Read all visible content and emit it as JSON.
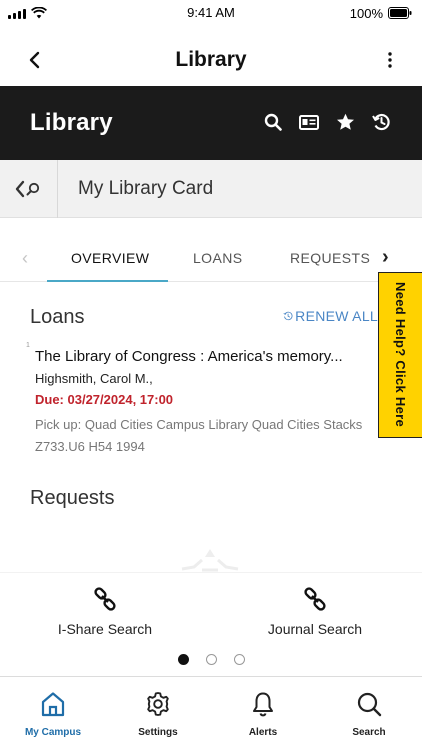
{
  "status_bar": {
    "time": "9:41 AM",
    "battery": "100%"
  },
  "app_header": {
    "title": "Library"
  },
  "banner": {
    "brand": "Library"
  },
  "card_bar": {
    "title": "My Library Card"
  },
  "tabs": [
    {
      "label": "OVERVIEW",
      "active": true
    },
    {
      "label": "LOANS",
      "active": false
    },
    {
      "label": "REQUESTS",
      "active": false
    }
  ],
  "help_tab": {
    "label": "Need Help? Click Here"
  },
  "loans": {
    "heading": "Loans",
    "renew_label": "RENEW ALL",
    "items": [
      {
        "title": "The Library of Congress : America's memory...",
        "author": "Highsmith, Carol M.,",
        "due": "Due: 03/27/2024, 17:00",
        "pickup": "Pick up: Quad Cities Campus Library Quad Cities Stacks Z733.U6 H54 1994",
        "index_mark": "1"
      }
    ]
  },
  "requests": {
    "heading": "Requests"
  },
  "quick_links": [
    {
      "label": "I-Share Search",
      "icon": "link-icon"
    },
    {
      "label": "Journal Search",
      "icon": "link-icon"
    }
  ],
  "pager": {
    "pages": 3,
    "current": 0
  },
  "bottom_nav": [
    {
      "label": "My Campus",
      "icon": "home-icon",
      "active": true
    },
    {
      "label": "Settings",
      "icon": "gear-icon",
      "active": false
    },
    {
      "label": "Alerts",
      "icon": "bell-icon",
      "active": false
    },
    {
      "label": "Search",
      "icon": "search-icon",
      "active": false
    }
  ],
  "colors": {
    "banner": "#1b1b1b",
    "tab_underline": "#4aa8c7",
    "due": "#c0232c",
    "help_tab": "#ffd200",
    "active_nav": "#1f6da8",
    "link": "#4a86c5"
  }
}
